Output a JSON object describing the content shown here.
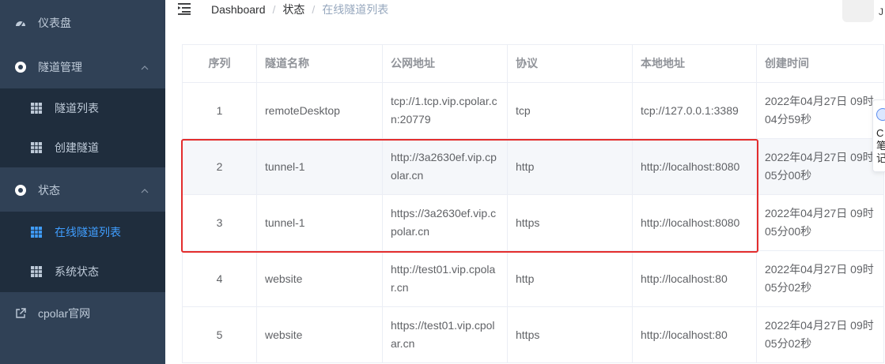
{
  "sidebar": {
    "items": [
      {
        "label": "仪表盘",
        "icon": "dashboard-icon"
      },
      {
        "label": "隧道管理",
        "icon": "circle-gear-icon"
      },
      {
        "label": "隧道列表",
        "icon": "grid-icon"
      },
      {
        "label": "创建隧道",
        "icon": "grid-icon"
      },
      {
        "label": "状态",
        "icon": "circle-gear-icon"
      },
      {
        "label": "在线隧道列表",
        "icon": "grid-icon"
      },
      {
        "label": "系统状态",
        "icon": "grid-icon"
      },
      {
        "label": "cpolar官网",
        "icon": "external-link-icon"
      }
    ],
    "active_color": "#409eff"
  },
  "header": {
    "breadcrumb": [
      "Dashboard",
      "状态",
      "在线隧道列表"
    ],
    "separator": "/",
    "avatar_caret": "J"
  },
  "table": {
    "columns": [
      "序列",
      "隧道名称",
      "公网地址",
      "协议",
      "本地地址",
      "创建时间"
    ],
    "rows": [
      {
        "idx": "1",
        "name": "remoteDesktop",
        "public": "tcp://1.tcp.vip.cpolar.cn:20779",
        "protocol": "tcp",
        "local": "tcp://127.0.0.1:3389",
        "created": "2022年04月27日 09时04分59秒"
      },
      {
        "idx": "2",
        "name": "tunnel-1",
        "public": "http://3a2630ef.vip.cpolar.cn",
        "protocol": "http",
        "local": "http://localhost:8080",
        "created": "2022年04月27日 09时05分00秒"
      },
      {
        "idx": "3",
        "name": "tunnel-1",
        "public": "https://3a2630ef.vip.cpolar.cn",
        "protocol": "https",
        "local": "http://localhost:8080",
        "created": "2022年04月27日 09时05分00秒"
      },
      {
        "idx": "4",
        "name": "website",
        "public": "http://test01.vip.cpolar.cn",
        "protocol": "http",
        "local": "http://localhost:80",
        "created": "2022年04月27日 09时05分02秒"
      },
      {
        "idx": "5",
        "name": "website",
        "public": "https://test01.vip.cpolar.cn",
        "protocol": "https",
        "local": "http://localhost:80",
        "created": "2022年04月27日 09时05分02秒"
      }
    ],
    "highlight_rows": [
      2,
      3
    ],
    "highlight_color": "#e32d2d"
  },
  "float_widget": {
    "text": "C笔记"
  }
}
